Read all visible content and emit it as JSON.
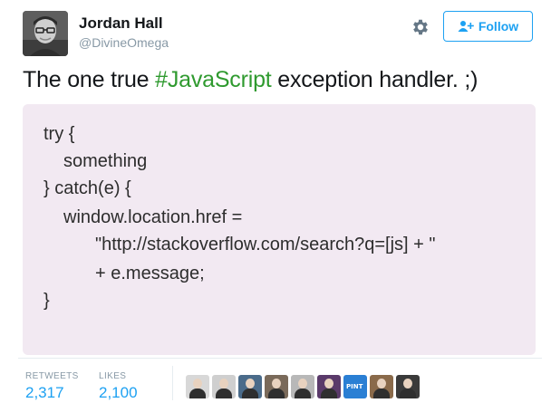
{
  "author": {
    "name": "Jordan Hall",
    "handle": "@DivineOmega"
  },
  "actions": {
    "settings_icon": "gear-icon",
    "follow_label": "Follow",
    "follow_icon": "add-user-icon"
  },
  "tweet": {
    "text_before": "The one true ",
    "hashtag": "#JavaScript",
    "text_after": " exception handler. ;)",
    "hashtag_color": "#2f9a2f"
  },
  "code": {
    "lines": [
      "try {",
      "something",
      "} catch(e) {",
      "window.location.href =",
      "\"http://stackoverflow.com/search?q=[js] + \"",
      "+ e.message;",
      "}"
    ],
    "background": "#f2e9f2"
  },
  "stats": {
    "retweets_label": "RETWEETS",
    "retweets_value": "2,317",
    "likes_label": "LIKES",
    "likes_value": "2,100"
  },
  "likers": [
    {
      "name": "liker-avatar-1",
      "color": "#d8d8d8"
    },
    {
      "name": "liker-avatar-2",
      "color": "#cfcfcf"
    },
    {
      "name": "liker-avatar-3",
      "color": "#4a6b8a"
    },
    {
      "name": "liker-avatar-4",
      "color": "#7a6a5a"
    },
    {
      "name": "liker-avatar-5",
      "color": "#b8b8b8"
    },
    {
      "name": "liker-avatar-6",
      "color": "#5a3a6a"
    },
    {
      "name": "liker-avatar-7",
      "color": "#2a7fd4",
      "label": "PINT"
    },
    {
      "name": "liker-avatar-8",
      "color": "#8a6a4a"
    },
    {
      "name": "liker-avatar-9",
      "color": "#3a3a3a"
    }
  ],
  "colors": {
    "accent": "#1da1f2",
    "muted": "#8899a6",
    "text": "#14171a"
  }
}
